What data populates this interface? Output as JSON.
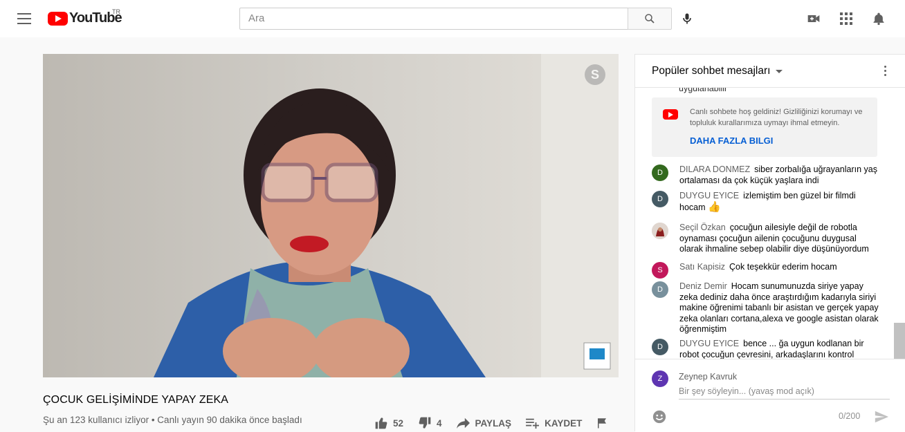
{
  "header": {
    "logo_text": "YouTube",
    "region": "TR",
    "search_placeholder": "Ara"
  },
  "video": {
    "title": "ÇOCUK GELİŞİMİNDE YAPAY ZEKA",
    "meta": "Şu an 123 kullanıcı izliyor • Canlı yayın 90 dakika önce başladı",
    "likes": "52",
    "dislikes": "4",
    "share_label": "PAYLAŞ",
    "save_label": "KAYDET"
  },
  "chat": {
    "header": "Popüler sohbet mesajları",
    "cut_text": "uygulanabilir",
    "welcome_text": "Canlı sohbete hoş geldiniz! Gizliliğinizi korumayı ve topluluk kurallarımıza uymayı ihmal etmeyin.",
    "welcome_link": "DAHA FAZLA BILGI",
    "messages": [
      {
        "initial": "D",
        "color": "#33691e",
        "author": "DILARA DONMEZ",
        "text": "siber zorbalığa uğrayanların yaş ortalaması da çok küçük yaşlara indi"
      },
      {
        "initial": "D",
        "color": "#455a64",
        "author": "DUYGU EYICE",
        "text": "izlemiştim ben güzel bir filmdi hocam"
      },
      {
        "initial": "",
        "color": "#a1887f",
        "author": "Seçil Özkan",
        "text": "çocuğun ailesiyle değil de robotla oynaması çocuğun ailenin çocuğunu duygusal olarak ihmaline sebep olabilir diye düşünüyordum"
      },
      {
        "initial": "S",
        "color": "#c2185b",
        "author": "Satı Kapisiz",
        "text": "Çok teşekkür ederim hocam"
      },
      {
        "initial": "D",
        "color": "#78909c",
        "author": "Deniz Demir",
        "text": "Hocam sunumunuzda siriye yapay zeka dediniz daha önce araştırdığım kadarıyla siriyi makine öğrenimi tabanlı bir asistan ve gerçek yapay zeka olanları cortana,alexa ve google asistan olarak öğrenmiştim"
      },
      {
        "initial": "D",
        "color": "#455a64",
        "author": "DUYGU EYICE",
        "text": "bence ... ğa uygun kodlanan bir robot çocuğun çevresini, arkadaşlarını kontrol"
      }
    ],
    "composer": {
      "initial": "Z",
      "name": "Zeynep Kavruk",
      "placeholder": "Bir şey söyleyin... (yavaş mod açık)",
      "count": "0/200"
    }
  }
}
